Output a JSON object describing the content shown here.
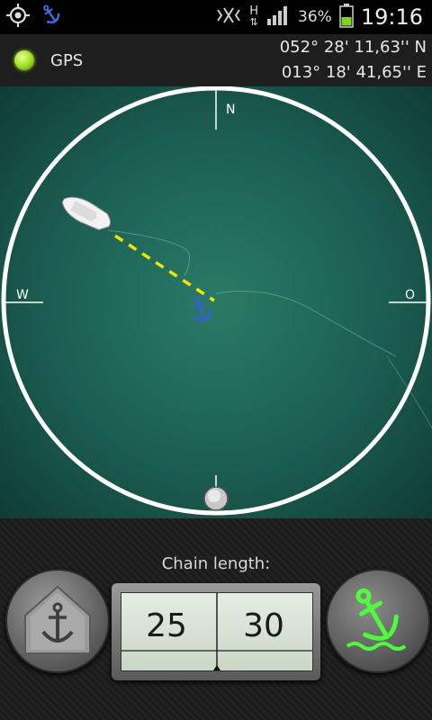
{
  "status_bar": {
    "battery_percent": "36%",
    "time": "19:16",
    "network_label": "H",
    "icons": [
      "gps-icon",
      "anchor-notification-icon",
      "vibrate-icon",
      "network-h-icon",
      "signal-icon",
      "battery-icon"
    ]
  },
  "gps": {
    "label": "GPS",
    "latitude": "052° 28' 11,63'' N",
    "longitude": "013° 18' 41,65'' E",
    "status_color": "#a6e628"
  },
  "compass": {
    "north": "N",
    "west": "W",
    "east": "O"
  },
  "chain": {
    "label": "Chain length:",
    "left_value": "25",
    "right_value": "30"
  },
  "colors": {
    "water": "#1b5e52",
    "ring": "#ffffff",
    "chain_line": "#f5e400",
    "anchor": "#3a5fd0",
    "active_anchor": "#4dff3a"
  }
}
